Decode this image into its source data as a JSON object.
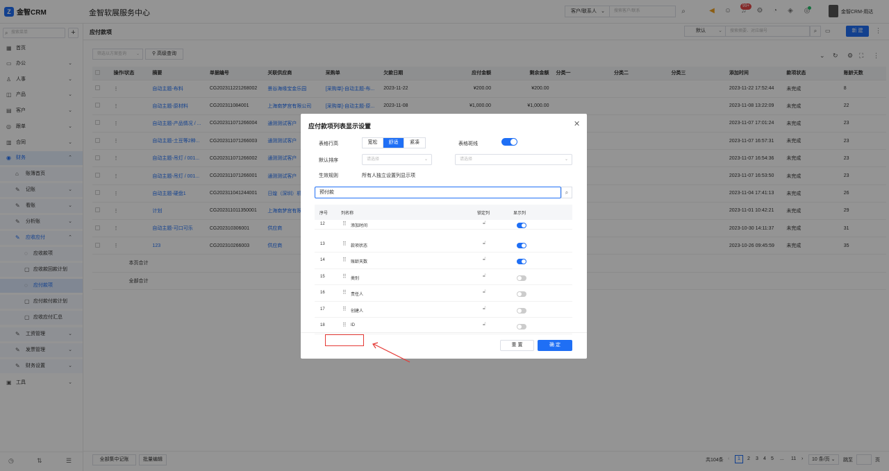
{
  "app": {
    "logo_text": "金智CRM",
    "title": "金智软展服务中心"
  },
  "topbar": {
    "search_type": "客户/联系人",
    "search_placeholder": "搜索客户/联系",
    "notification_badge": "99+",
    "user_name": "金智CRM-用达"
  },
  "sidebar": {
    "search_placeholder": "搜索菜单",
    "items": [
      {
        "label": "首页"
      },
      {
        "label": "办公"
      },
      {
        "label": "人事"
      },
      {
        "label": "产品"
      },
      {
        "label": "客户"
      },
      {
        "label": "跟单"
      },
      {
        "label": "合同"
      },
      {
        "label": "财务"
      },
      {
        "label": "账簿首页"
      },
      {
        "label": "记账"
      },
      {
        "label": "看账"
      },
      {
        "label": "分析账"
      },
      {
        "label": "应收应付"
      },
      {
        "label": "应收款项"
      },
      {
        "label": "应收款回款计划"
      },
      {
        "label": "应付款项"
      },
      {
        "label": "应付款付款计划"
      },
      {
        "label": "应收应付汇总"
      },
      {
        "label": "工资管理"
      },
      {
        "label": "发票管理"
      },
      {
        "label": "财务设置"
      },
      {
        "label": "工具"
      }
    ]
  },
  "page": {
    "title": "应付款项",
    "view_select": "默认",
    "search_placeholder": "搜索摘要、对应编号",
    "new_button": "新 建",
    "filter_placeholder": "筛选以方案查询",
    "advanced_query": "高级查询"
  },
  "table": {
    "columns": [
      "操作/状态",
      "摘要",
      "单据编号",
      "关联供应商",
      "采购单",
      "欠款日期",
      "应付金额",
      "剩余金额",
      "分类一",
      "分类二",
      "分类三",
      "添加时间",
      "款项状态",
      "账龄天数"
    ],
    "rows": [
      [
        "自动主题-布料",
        "CG202311221268002",
        "景谷海缘宝金乐园",
        "[采购单]-自动主题-布...",
        "2023-11-22",
        "¥200.00",
        "¥200.00",
        "2023-11-22 17:52:44",
        "未完成",
        "8"
      ],
      [
        "自动主题-原材料",
        "CG202311084001",
        "上海南梦宫有限公司",
        "[采购单]-自动主题-原...",
        "2023-11-08",
        "¥1,000.00",
        "¥1,000.00",
        "2023-11-08 13:22:09",
        "未完成",
        "22"
      ],
      [
        "自动主题-产品情况 / ...",
        "CG202311071266004",
        "通测测试客户",
        "",
        "",
        "",
        "",
        "2023-11-07 17:01:24",
        "未完成",
        "23"
      ],
      [
        "自动主题-土豆等2种...",
        "CG202311071266003",
        "通测测试客户",
        "",
        "",
        "",
        "",
        "2023-11-07 16:57:31",
        "未完成",
        "23"
      ],
      [
        "自动主题-吊灯 / 001...",
        "CG202311071266002",
        "通测测试客户",
        "",
        "",
        "",
        "",
        "2023-11-07 16:54:36",
        "未完成",
        "23"
      ],
      [
        "自动主题-吊灯 / 001...",
        "CG202311071266001",
        "通测测试客户",
        "",
        "",
        "",
        "",
        "2023-11-07 16:53:50",
        "未完成",
        "23"
      ],
      [
        "自动主题-硬盘1",
        "CG202311041244001",
        "日煌（深圳）机",
        "",
        "",
        "",
        "",
        "2023-11-04 17:41:13",
        "未完成",
        "26"
      ],
      [
        "计划",
        "CG202311011350001",
        "上海南梦宫有限",
        "",
        "",
        "",
        "",
        "2023-11-01 10:42:21",
        "未完成",
        "29"
      ],
      [
        "自动主题-可口可乐",
        "CG202310306001",
        "供应商",
        "",
        "",
        "",
        "",
        "2023-10-30 14:11:37",
        "未完成",
        "31"
      ],
      [
        "123",
        "CG202310266003",
        "供应商",
        "",
        "",
        "",
        "",
        "2023-10-26 09:45:59",
        "未完成",
        "35"
      ]
    ],
    "page_total_label": "本页合计",
    "all_total_label": "全部合计"
  },
  "footer": {
    "btn_all_records": "全部集中记账",
    "btn_batch_edit": "批量编辑",
    "total": "共104条",
    "pages": [
      "1",
      "2",
      "3",
      "4",
      "5",
      "...",
      "11"
    ],
    "page_size": "10 条/页",
    "goto_label": "跳至",
    "goto_suffix": "页"
  },
  "modal": {
    "title": "应付款项列表显示设置",
    "row_height_label": "表格行高",
    "row_height_options": [
      "宽松",
      "舒适",
      "紧凑"
    ],
    "row_height_selected": "舒适",
    "zebra_label": "表格斑线",
    "zebra_on": true,
    "default_sort_label": "默认排序",
    "sort_placeholder_1": "请选择",
    "sort_placeholder_2": "请选择",
    "rule_label": "生效规则",
    "rule_value": "所有人独立设置列显示项",
    "search_value": "预付款",
    "col_headers": [
      "序号",
      "列名称",
      "锁定列",
      "显示列"
    ],
    "columns": [
      {
        "no": "12",
        "name": "添加时间",
        "show": true
      },
      {
        "no": "13",
        "name": "款项状态",
        "show": true
      },
      {
        "no": "14",
        "name": "账龄天数",
        "show": true
      },
      {
        "no": "15",
        "name": "类别",
        "show": false
      },
      {
        "no": "16",
        "name": "责任人",
        "show": false
      },
      {
        "no": "17",
        "name": "创建人",
        "show": false
      },
      {
        "no": "18",
        "name": "ID",
        "show": false
      }
    ],
    "reset": "重 置",
    "confirm": "确 定"
  },
  "colors": {
    "accent": "#1f6ff5",
    "annotation": "#e53935",
    "badge": "#e54848"
  }
}
